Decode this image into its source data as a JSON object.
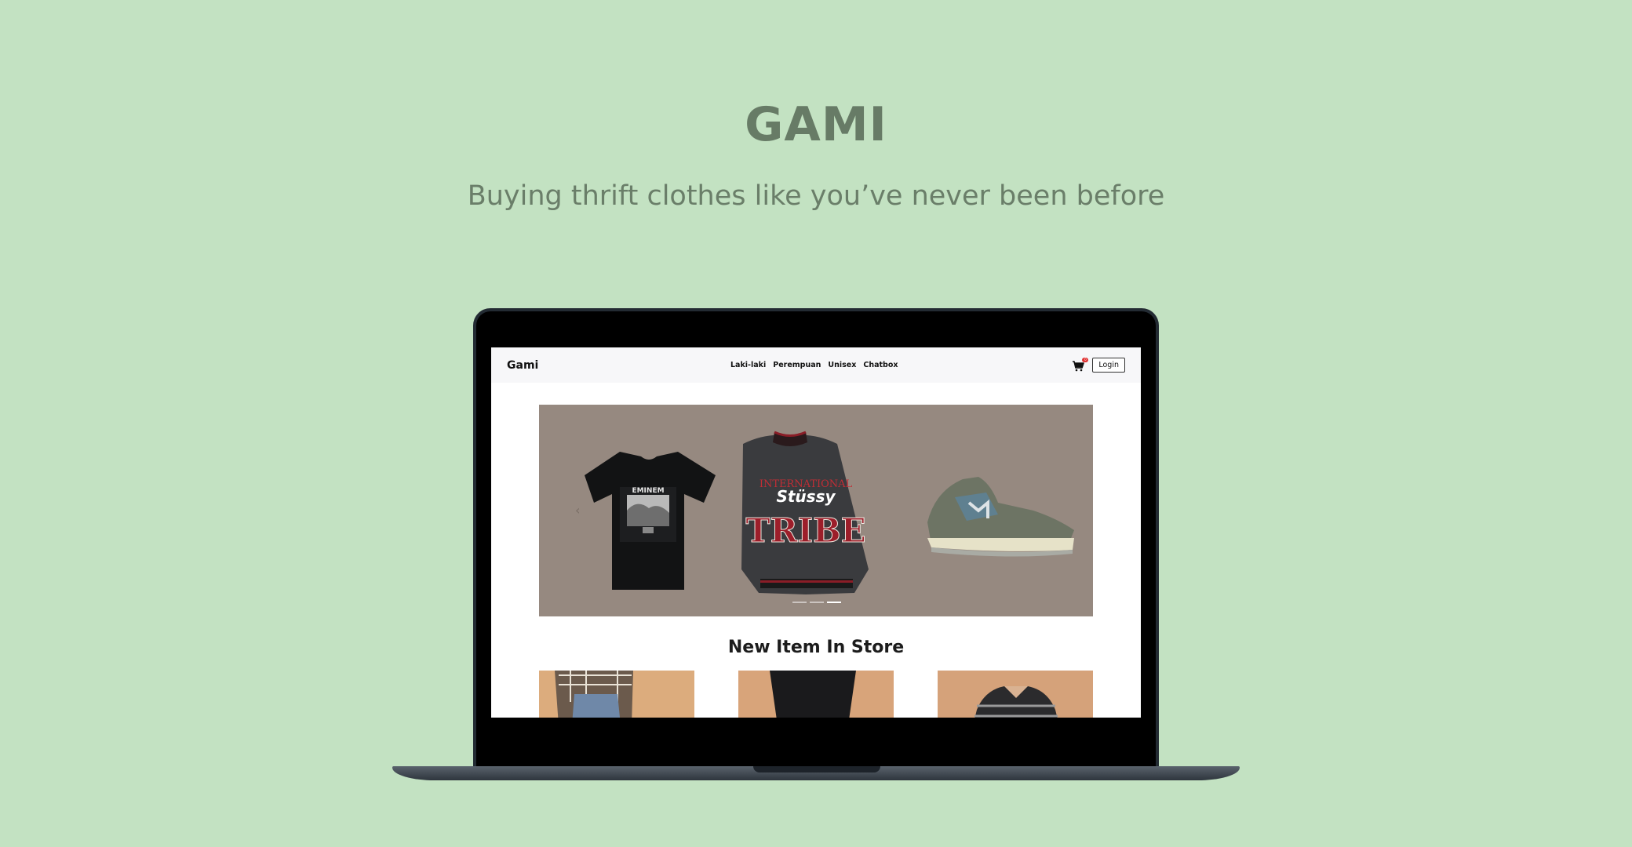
{
  "hero": {
    "title": "GAMI",
    "tagline": "Buying thrift clothes like you’ve never been before"
  },
  "site": {
    "brand": "Gami",
    "nav": [
      "Laki-laki",
      "Perempuan",
      "Unisex",
      "Chatbox"
    ],
    "cart_count": "0",
    "login_label": "Login",
    "carousel": {
      "items": [
        "t-shirt",
        "varsity-jacket",
        "sneaker"
      ],
      "shirt_print": "EMINEM",
      "jacket_script": "Stüssy",
      "jacket_arc": "INTERNATIONAL",
      "jacket_word": "TRIBE",
      "slides": 3,
      "active_slide": 3
    },
    "section_title": "New Item In Store",
    "products": [
      "plaid-shirt",
      "black-pants",
      "striped-polo"
    ]
  },
  "colors": {
    "background": "#c3e2c2",
    "heading": "#677b66",
    "carousel_bg": "#968980",
    "card_bg": "#dcac7d"
  }
}
